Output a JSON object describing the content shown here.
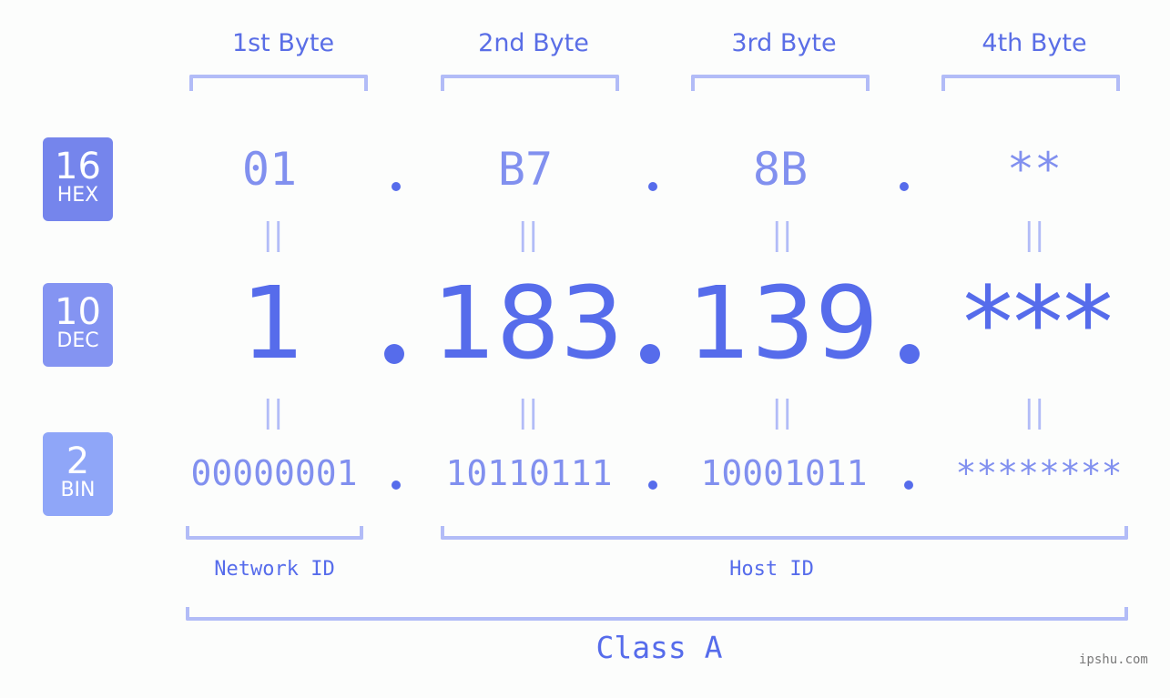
{
  "bytes": [
    {
      "label": "1st Byte",
      "hex": "01",
      "dec": "1",
      "bin": "00000001"
    },
    {
      "label": "2nd Byte",
      "hex": "B7",
      "dec": "183",
      "bin": "10110111"
    },
    {
      "label": "3rd Byte",
      "hex": "8B",
      "dec": "139",
      "bin": "10001011"
    },
    {
      "label": "4th Byte",
      "hex": "**",
      "dec": "***",
      "bin": "********"
    }
  ],
  "badges": {
    "hex": {
      "num": "16",
      "sub": "HEX",
      "color": "#7585ec"
    },
    "dec": {
      "num": "10",
      "sub": "DEC",
      "color": "#8494f2"
    },
    "bin": {
      "num": "2",
      "sub": "BIN",
      "color": "#8fa6f8"
    }
  },
  "equals_sign": "||",
  "network_id_label": "Network ID",
  "host_id_label": "Host ID",
  "class_label": "Class A",
  "watermark": "ipshu.com",
  "colors": {
    "accent": "#566ceb",
    "light_accent": "#8190ef",
    "bracket": "#b2bcf7"
  }
}
